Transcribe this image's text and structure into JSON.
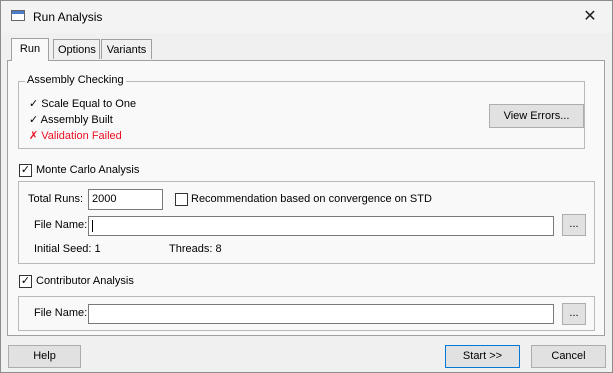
{
  "window": {
    "title": "Run Analysis",
    "close_glyph": "✕"
  },
  "tabs": [
    {
      "label": "Run",
      "active": true
    },
    {
      "label": "Options",
      "active": false
    },
    {
      "label": "Variants",
      "active": false
    }
  ],
  "assembly_checking": {
    "title": "Assembly Checking",
    "checks": [
      {
        "mark": "✓",
        "text": "Scale Equal to One",
        "status": "ok"
      },
      {
        "mark": "✓",
        "text": "Assembly Built",
        "status": "ok"
      },
      {
        "mark": "✗",
        "text": "Validation Failed",
        "status": "error"
      }
    ],
    "view_errors_label": "View Errors...",
    "error_color": "#e81123"
  },
  "monte_carlo": {
    "checkbox_label": "Monte Carlo Analysis",
    "checked": true,
    "total_runs_label": "Total Runs:",
    "total_runs_value": "2000",
    "recommendation_label": "Recommendation based on convergence on STD",
    "recommendation_checked": false,
    "file_name_label": "File Name:",
    "file_name_value": "",
    "browse_label": "...",
    "initial_seed_label": "Initial Seed: 1",
    "threads_label": "Threads: 8"
  },
  "contributor": {
    "checkbox_label": "Contributor Analysis",
    "checked": true,
    "file_name_label": "File Name:",
    "file_name_value": "",
    "browse_label": "..."
  },
  "footer": {
    "help_label": "Help",
    "start_label": "Start >>",
    "cancel_label": "Cancel"
  }
}
